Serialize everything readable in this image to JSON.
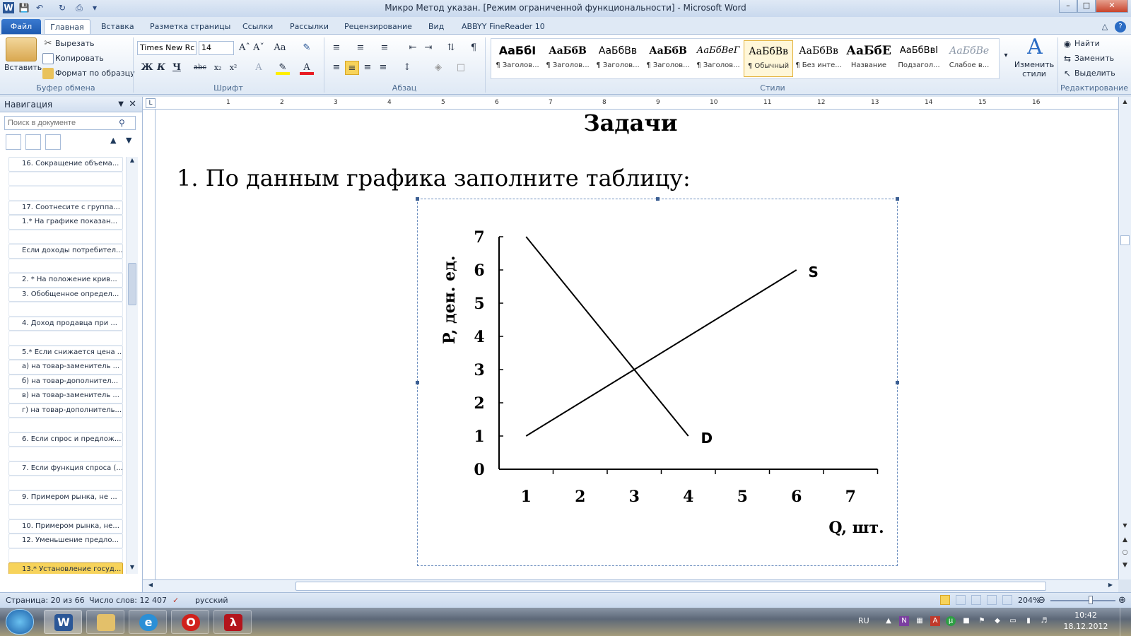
{
  "window": {
    "title": "Микро Метод указан. [Режим ограниченной функциональности]  -  Microsoft Word"
  },
  "tabs": [
    {
      "label": "Файл"
    },
    {
      "label": "Главная"
    },
    {
      "label": "Вставка"
    },
    {
      "label": "Разметка страницы"
    },
    {
      "label": "Ссылки"
    },
    {
      "label": "Рассылки"
    },
    {
      "label": "Рецензирование"
    },
    {
      "label": "Вид"
    },
    {
      "label": "ABBYY FineReader 10"
    }
  ],
  "ribbon": {
    "clipboard": {
      "paste": "Вставить",
      "cut": "Вырезать",
      "copy": "Копировать",
      "format_painter": "Формат по образцу",
      "group": "Буфер обмена"
    },
    "font": {
      "name": "Times New Rc",
      "size": "14",
      "bold": "Ж",
      "italic": "К",
      "underline": "Ч",
      "strike": "abc",
      "sub": "x₂",
      "sup": "x²",
      "group": "Шрифт"
    },
    "paragraph": {
      "group": "Абзац"
    },
    "styles": {
      "group": "Стили",
      "items": [
        {
          "sample": "АаБбІ",
          "name": "¶ Заголов..."
        },
        {
          "sample": "АаБбВ",
          "name": "¶ Заголов..."
        },
        {
          "sample": "АаБбВв",
          "name": "¶ Заголов..."
        },
        {
          "sample": "АаБбВ",
          "name": "¶ Заголов..."
        },
        {
          "sample": "АаБбВеГ",
          "name": "¶ Заголов..."
        },
        {
          "sample": "АаБбВв",
          "name": "¶ Обычный"
        },
        {
          "sample": "АаБбВв",
          "name": "¶ Без инте..."
        },
        {
          "sample": "АаБбЕ",
          "name": "Название"
        },
        {
          "sample": "АаБбВвІ",
          "name": "Подзагол..."
        },
        {
          "sample": "АаБбВе",
          "name": "Слабое в..."
        }
      ],
      "change": "Изменить стили"
    },
    "editing": {
      "find": "Найти",
      "replace": "Заменить",
      "select": "Выделить",
      "group": "Редактирование"
    }
  },
  "nav": {
    "title": "Навигация",
    "search_placeholder": "Поиск в документе",
    "items": [
      {
        "label": "16. Сокращение объема..."
      },
      {
        "label": ""
      },
      {
        "label": ""
      },
      {
        "label": "17. Соотнесите с группа..."
      },
      {
        "label": "1.* На графике показан..."
      },
      {
        "label": ""
      },
      {
        "label": "Если доходы потребител..."
      },
      {
        "label": ""
      },
      {
        "label": "2. * На положение крив..."
      },
      {
        "label": "3. Обобщенное определ..."
      },
      {
        "label": ""
      },
      {
        "label": "4. Доход продавца при ..."
      },
      {
        "label": ""
      },
      {
        "label": "5.* Если снижается цена ..."
      },
      {
        "label": "а) на товар-заменитель ..."
      },
      {
        "label": "б) на товар-дополнител..."
      },
      {
        "label": "в) на товар-заменитель ..."
      },
      {
        "label": "г) на товар-дополнитель..."
      },
      {
        "label": ""
      },
      {
        "label": "6. Если спрос и предлож..."
      },
      {
        "label": ""
      },
      {
        "label": "7. Если функция спроса (..."
      },
      {
        "label": ""
      },
      {
        "label": "9. Примером рынка, не ..."
      },
      {
        "label": ""
      },
      {
        "label": "10. Примером рынка, не..."
      },
      {
        "label": "12. Уменьшение предло..."
      },
      {
        "label": ""
      },
      {
        "label": "13.* Установление госуд..."
      }
    ]
  },
  "ruler": {
    "marks": [
      "1",
      "2",
      "3",
      "4",
      "5",
      "6",
      "7",
      "8",
      "9",
      "10",
      "11",
      "12",
      "13",
      "14",
      "15",
      "16"
    ]
  },
  "document": {
    "heading": "Задачи",
    "task": "1. По данным графика заполните таблицу:"
  },
  "chart_data": {
    "type": "line",
    "xlabel": "Q, шт.",
    "ylabel": "P, ден. ед.",
    "xticks": [
      "1",
      "2",
      "3",
      "4",
      "5",
      "6",
      "7"
    ],
    "yticks": [
      "0",
      "1",
      "2",
      "3",
      "4",
      "5",
      "6",
      "7"
    ],
    "xlim": [
      0.5,
      7.5
    ],
    "ylim": [
      0,
      7
    ],
    "grid": false,
    "series": [
      {
        "name": "D",
        "points": [
          [
            1,
            7
          ],
          [
            4,
            1
          ]
        ]
      },
      {
        "name": "S",
        "points": [
          [
            1,
            1
          ],
          [
            6,
            6
          ]
        ]
      }
    ]
  },
  "status": {
    "page": "Страница: 20 из 66",
    "words": "Число слов: 12 407",
    "lang": "русский",
    "zoom": "204%"
  },
  "taskbar": {
    "lang": "RU",
    "time": "10:42",
    "date": "18.12.2012"
  }
}
